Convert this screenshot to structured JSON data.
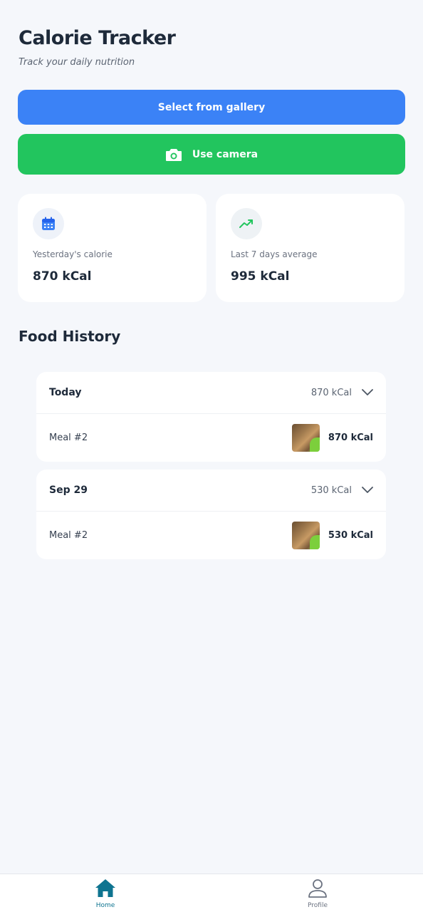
{
  "header": {
    "title": "Calorie Tracker",
    "subtitle": "Track your daily nutrition"
  },
  "actions": {
    "gallery_label": "Select from gallery",
    "camera_label": "Use camera",
    "gallery_color": "#3b82f6",
    "camera_color": "#22c55e"
  },
  "stats": [
    {
      "icon": "calendar-icon",
      "label": "Yesterday's calorie",
      "value": "870 kCal"
    },
    {
      "icon": "trending-up-icon",
      "label": "Last 7 days average",
      "value": "995 kCal"
    }
  ],
  "history": {
    "title": "Food History",
    "days": [
      {
        "label": "Today",
        "total": "870 kCal",
        "meals": [
          {
            "name": "Meal #2",
            "kcal": "870 kCal"
          }
        ]
      },
      {
        "label": "Sep 29",
        "total": "530 kCal",
        "meals": [
          {
            "name": "Meal #2",
            "kcal": "530 kCal"
          }
        ]
      }
    ]
  },
  "nav": {
    "items": [
      {
        "label": "Home",
        "icon": "home-icon",
        "active": true
      },
      {
        "label": "Profile",
        "icon": "user-icon",
        "active": false
      }
    ]
  }
}
